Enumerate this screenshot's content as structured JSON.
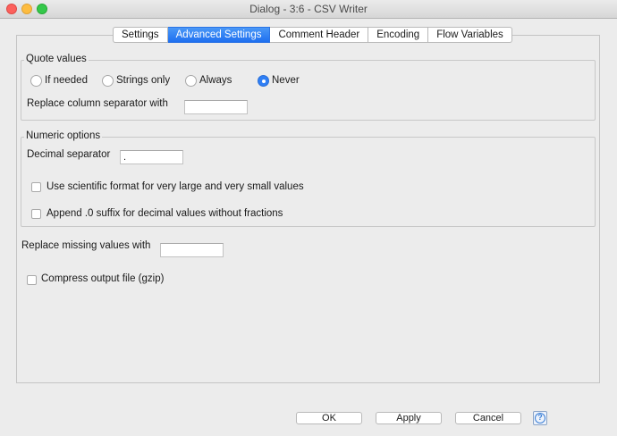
{
  "window": {
    "title": "Dialog - 3:6 - CSV Writer"
  },
  "tabs": [
    {
      "label": "Settings",
      "active": false
    },
    {
      "label": "Advanced Settings",
      "active": true
    },
    {
      "label": "Comment Header",
      "active": false
    },
    {
      "label": "Encoding",
      "active": false
    },
    {
      "label": "Flow Variables",
      "active": false
    }
  ],
  "quote_values": {
    "legend": "Quote values",
    "options": [
      "If needed",
      "Strings only",
      "Always",
      "Never"
    ],
    "selected": "Never",
    "separator_label": "Replace column separator with",
    "separator_value": ""
  },
  "numeric_options": {
    "legend": "Numeric options",
    "decimal_label": "Decimal separator",
    "decimal_value": ".",
    "scientific_label": "Use scientific format for very large and very small values",
    "scientific_checked": false,
    "suffix_label": "Append .0 suffix for decimal values without fractions",
    "suffix_checked": false
  },
  "missing": {
    "label": "Replace missing values with",
    "value": ""
  },
  "compress": {
    "label": "Compress output file (gzip)",
    "checked": false
  },
  "buttons": {
    "ok": "OK",
    "apply": "Apply",
    "cancel": "Cancel",
    "help": "?"
  },
  "colors": {
    "accent": "#2f7ff5",
    "tab_active": "#1e6ff0"
  }
}
